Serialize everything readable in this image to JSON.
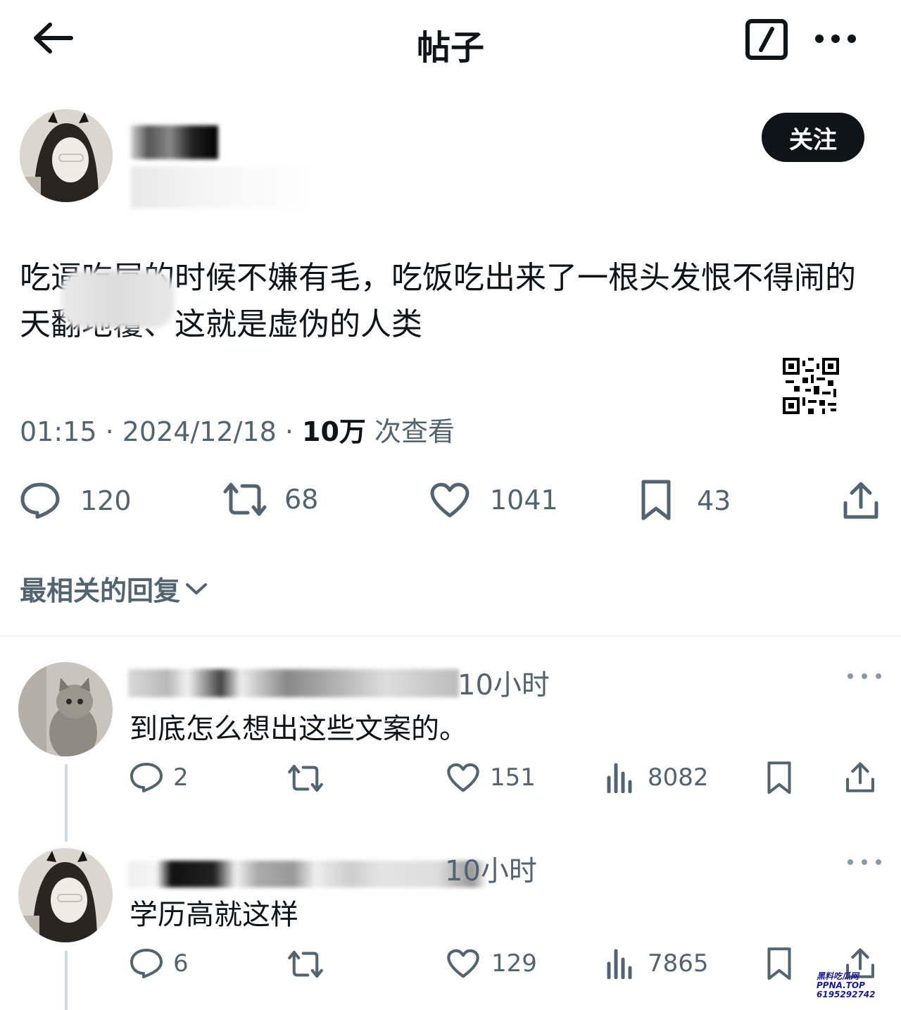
{
  "header": {
    "title": "帖子"
  },
  "post": {
    "follow_label": "关注",
    "text": "吃逼吃屌的时候不嫌有毛，吃饭吃出来了一根头发恨不得闹的天翻地覆、这就是虚伪的人类",
    "meta_time": "01:15 · 2024/12/18 · ",
    "views_count": "10万",
    "views_label": " 次查看",
    "stats": {
      "replies": "120",
      "reposts": "68",
      "likes": "1041",
      "bookmarks": "43"
    }
  },
  "replies_sort_label": "最相关的回复",
  "replies": [
    {
      "time": "10小时",
      "text": "到底怎么想出这些文案的。",
      "replies": "2",
      "likes": "151",
      "views": "8082"
    },
    {
      "time": "10小时",
      "text": "学历高就这样",
      "replies": "6",
      "likes": "129",
      "views": "7865"
    }
  ],
  "watermark": {
    "line1": "黑料吃瓜网",
    "line2": "PPNA.TOP",
    "line3": "6195292742"
  },
  "icons": {
    "back": "arrow-left-icon",
    "edit": "edit-icon",
    "more": "more-horizontal-icon",
    "reply": "speech-bubble-icon",
    "repost": "repost-icon",
    "like": "heart-icon",
    "bookmark": "bookmark-icon",
    "share": "share-icon",
    "views": "bar-chart-icon"
  },
  "colors": {
    "text": "#0f1419",
    "muted": "#536471",
    "follow_bg": "#0f1419"
  }
}
